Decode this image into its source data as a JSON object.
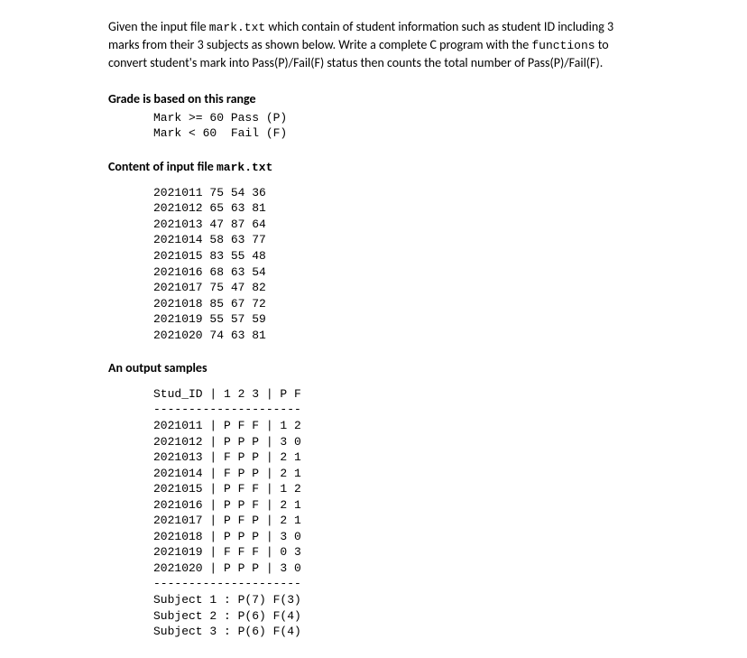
{
  "intro": {
    "text": "Given the input file mark.txt which contain of student information such as student ID including 3 marks from their 3 subjects as shown below. Write a complete C program with the functions to convert student's mark into Pass(P)/Fail(F) status then counts the total number of Pass(P)/Fail(F)."
  },
  "gradeLabel": "Grade is based on this range",
  "gradeRules": "Mark >= 60 Pass (P)\nMark < 60  Fail (F)",
  "inputLabel": "Content of input file mark.txt",
  "inputContent": "2021011 75 54 36\n2021012 65 63 81\n2021013 47 87 64\n2021014 58 63 77\n2021015 83 55 48\n2021016 68 63 54\n2021017 75 47 82\n2021018 85 67 72\n2021019 55 57 59\n2021020 74 63 81",
  "outputLabel": "An output samples",
  "outputContent": "Stud_ID | 1 2 3 | P F\n---------------------\n2021011 | P F F | 1 2\n2021012 | P P P | 3 0\n2021013 | F P P | 2 1\n2021014 | F P P | 2 1\n2021015 | P F F | 1 2\n2021016 | P P F | 2 1\n2021017 | P F P | 2 1\n2021018 | P P P | 3 0\n2021019 | F F F | 0 3\n2021020 | P P P | 3 0\n---------------------\nSubject 1 : P(7) F(3)\nSubject 2 : P(6) F(4)\nSubject 3 : P(6) F(4)"
}
